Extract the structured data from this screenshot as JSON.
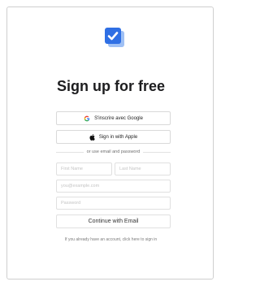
{
  "header": {
    "title": "Sign up for free",
    "logo_icon": "checkbox-check-icon",
    "logo_color": "#2f6fe4",
    "logo_shadow_color": "#9fc0f5"
  },
  "social": {
    "google_label": "S'inscrire avec Google",
    "google_icon": "google-g-icon",
    "apple_label": "Sign in with Apple",
    "apple_icon": "apple-icon"
  },
  "divider": {
    "text": "or use email and password"
  },
  "form": {
    "first_name_placeholder": "First Name",
    "last_name_placeholder": "Last Name",
    "email_placeholder": "you@example.com",
    "password_placeholder": "Password",
    "submit_label": "Continue with Email"
  },
  "footer": {
    "signin_text": "If you already have an account, click here to sign in"
  }
}
